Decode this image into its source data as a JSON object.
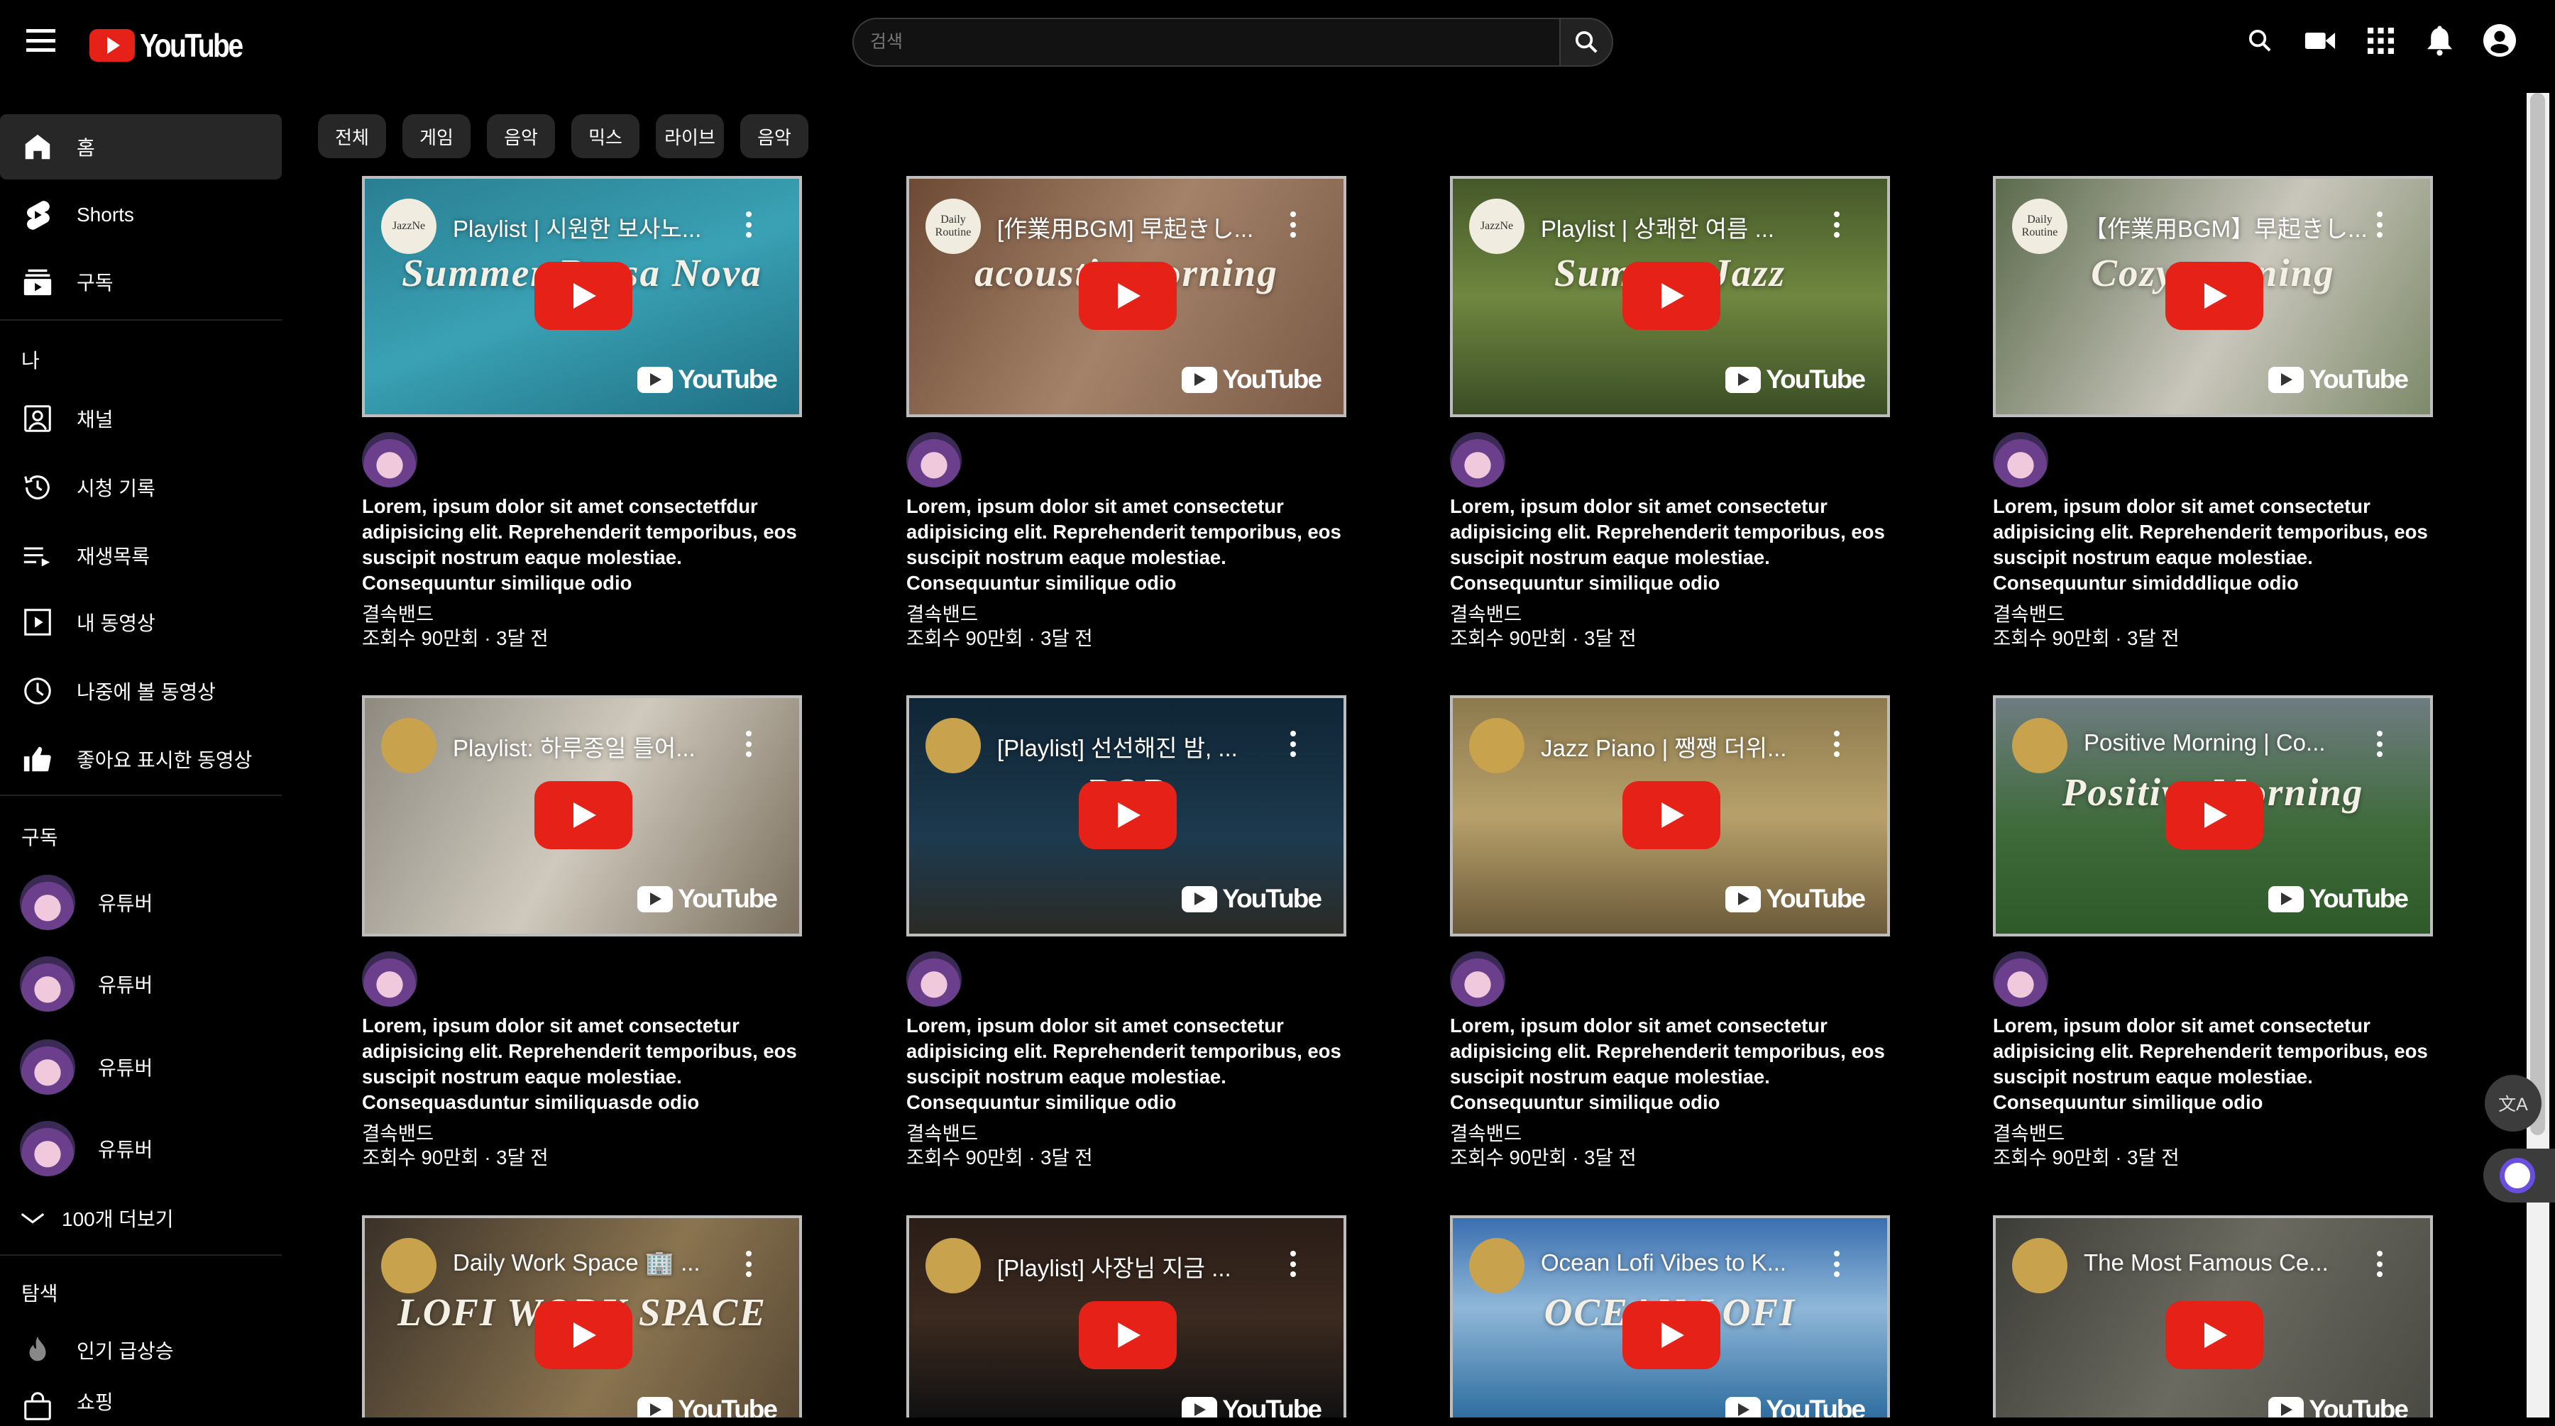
{
  "header": {
    "logo_text": "YouTube",
    "search_placeholder": "검색",
    "icons": [
      "menu-icon",
      "search-icon",
      "video-camera-icon",
      "apps-grid-icon",
      "bell-icon",
      "account-icon"
    ]
  },
  "sidebar": {
    "main": [
      {
        "label": "홈",
        "icon": "home-icon",
        "active": true
      },
      {
        "label": "Shorts",
        "icon": "shorts-icon"
      },
      {
        "label": "구독",
        "icon": "subscriptions-icon"
      }
    ],
    "me_heading": "나",
    "me": [
      {
        "label": "채널",
        "icon": "channel-icon"
      },
      {
        "label": "시청 기록",
        "icon": "history-icon"
      },
      {
        "label": "재생목록",
        "icon": "playlist-icon"
      },
      {
        "label": "내 동영상",
        "icon": "my-videos-icon"
      },
      {
        "label": "나중에 볼 동영상",
        "icon": "watch-later-icon"
      },
      {
        "label": "좋아요 표시한 동영상",
        "icon": "thumbs-up-icon"
      }
    ],
    "subs_heading": "구독",
    "subs": [
      {
        "label": "유튜버"
      },
      {
        "label": "유튜버"
      },
      {
        "label": "유튜버"
      },
      {
        "label": "유튜버"
      }
    ],
    "more_label": "100개 더보기",
    "explore_heading": "탐색",
    "explore": [
      {
        "label": "인기 급상승",
        "icon": "trending-icon"
      },
      {
        "label": "쇼핑",
        "icon": "shopping-icon"
      }
    ]
  },
  "chips": [
    "전체",
    "게임",
    "음악",
    "믹스",
    "라이브",
    "음악"
  ],
  "cards": [
    {
      "thumb_title": "Playlist | 시원한 보사노...",
      "channel_badge": "JazzNe",
      "art": "Summer Bossa Nova",
      "bg": "linear-gradient(160deg,#2a7f92,#3aa1b4 50%,#1f6f83)",
      "desc": "Lorem, ipsum dolor sit amet consectetfdur adipisicing elit. Reprehenderit temporibus, eos suscipit nostrum eaque molestiae. Consequuntur similique odio",
      "channel": "결속밴드",
      "meta": "조회수 90만회 · 3달 전"
    },
    {
      "thumb_title": "[作業用BGM] 早起きし...",
      "channel_badge": "Daily Routine",
      "art": "acoustic morning",
      "bg": "linear-gradient(120deg,#6d4a33,#a4826a 50%,#7a5a45)",
      "desc": "Lorem, ipsum dolor sit amet consectetur adipisicing elit. Reprehenderit temporibus, eos suscipit nostrum eaque molestiae. Consequuntur similique odio",
      "channel": "결속밴드",
      "meta": "조회수 90만회 · 3달 전"
    },
    {
      "thumb_title": "Playlist | 상쾌한 여름 ...",
      "channel_badge": "JazzNe",
      "art": "Summer Jazz",
      "bg": "linear-gradient(180deg,#46582a,#6f8740 50%,#3a4d25)",
      "desc": "Lorem, ipsum dolor sit amet consectetur adipisicing elit. Reprehenderit temporibus, eos suscipit nostrum eaque molestiae. Consequuntur similique odio",
      "channel": "결속밴드",
      "meta": "조회수 90만회 · 3달 전"
    },
    {
      "thumb_title": "【作業用BGM】早起きし...",
      "channel_badge": "Daily Routine",
      "art": "Cozy morning",
      "bg": "linear-gradient(120deg,#5b6a4c,#c9c6bc 55%,#7d8a6a)",
      "desc": "Lorem, ipsum dolor sit amet consectetur adipisicing elit. Reprehenderit temporibus, eos suscipit nostrum eaque molestiae. Consequuntur simidddlique odio",
      "channel": "결속밴드",
      "meta": "조회수 90만회 · 3달 전"
    },
    {
      "thumb_title": "Playlist: 하루종일 틀어...",
      "channel_badge": "",
      "art": "",
      "bg": "linear-gradient(120deg,#8e8a80,#cfc9bd 50%,#7a6f5d)",
      "desc": "Lorem, ipsum dolor sit amet consectetur adipisicing elit. Reprehenderit temporibus, eos suscipit nostrum eaque molestiae. Consequasduntur similiquasde odio",
      "channel": "결속밴드",
      "meta": "조회수 90만회 · 3달 전"
    },
    {
      "thumb_title": "[Playlist] 선선해진 밤, ...",
      "channel_badge": "",
      "art": "POP",
      "bg": "linear-gradient(180deg,#0f2535,#1d3a4e 60%,#2b2a25)",
      "desc": "Lorem, ipsum dolor sit amet consectetur adipisicing elit. Reprehenderit temporibus, eos suscipit nostrum eaque molestiae. Consequuntur similique odio",
      "channel": "결속밴드",
      "meta": "조회수 90만회 · 3달 전"
    },
    {
      "thumb_title": "Jazz Piano | 쨍쨍 더위...",
      "channel_badge": "",
      "art": "",
      "bg": "linear-gradient(180deg,#8c7a4e,#b7a06a 50%,#6b5a3a)",
      "desc": "Lorem, ipsum dolor sit amet consectetur adipisicing elit. Reprehenderit temporibus, eos suscipit nostrum eaque molestiae. Consequuntur similique odio",
      "channel": "결속밴드",
      "meta": "조회수 90만회 · 3달 전"
    },
    {
      "thumb_title": "Positive Morning | Co...",
      "channel_badge": "",
      "art": "Positive Morning",
      "bg": "linear-gradient(180deg,#6f7c82,#3f6b3a 55%,#2e5a2a)",
      "desc": "Lorem, ipsum dolor sit amet consectetur adipisicing elit. Reprehenderit temporibus, eos suscipit nostrum eaque molestiae. Consequuntur similique odio",
      "channel": "결속밴드",
      "meta": "조회수 90만회 · 3달 전"
    },
    {
      "thumb_title": "Daily Work Space 🏢 ...",
      "channel_badge": "",
      "art": "LOFI WORK SPACE",
      "bg": "linear-gradient(120deg,#3a3128,#8a7450 60%,#5a4a35)",
      "desc": "",
      "channel": "",
      "meta": ""
    },
    {
      "thumb_title": "[Playlist] 사장님 지금 ...",
      "channel_badge": "",
      "art": "",
      "bg": "linear-gradient(180deg,#2a1d17,#3b2a20 50%,#111)",
      "desc": "",
      "channel": "",
      "meta": ""
    },
    {
      "thumb_title": "Ocean Lofi Vibes to K...",
      "channel_badge": "",
      "art": "OCEAN LOFI",
      "bg": "linear-gradient(180deg,#3a6fb0,#8fb7d8 45%,#2f6ea0)",
      "desc": "",
      "channel": "",
      "meta": ""
    },
    {
      "thumb_title": "The Most Famous Ce...",
      "channel_badge": "",
      "art": "",
      "bg": "linear-gradient(120deg,#3d3d38,#6b6a60 50%,#4a4a44)",
      "desc": "",
      "channel": "",
      "meta": ""
    }
  ],
  "widgets": {
    "translate_label": "文A"
  },
  "colors": {
    "brand_red": "#e62117",
    "chip_bg": "#272727",
    "bg": "#000000"
  }
}
